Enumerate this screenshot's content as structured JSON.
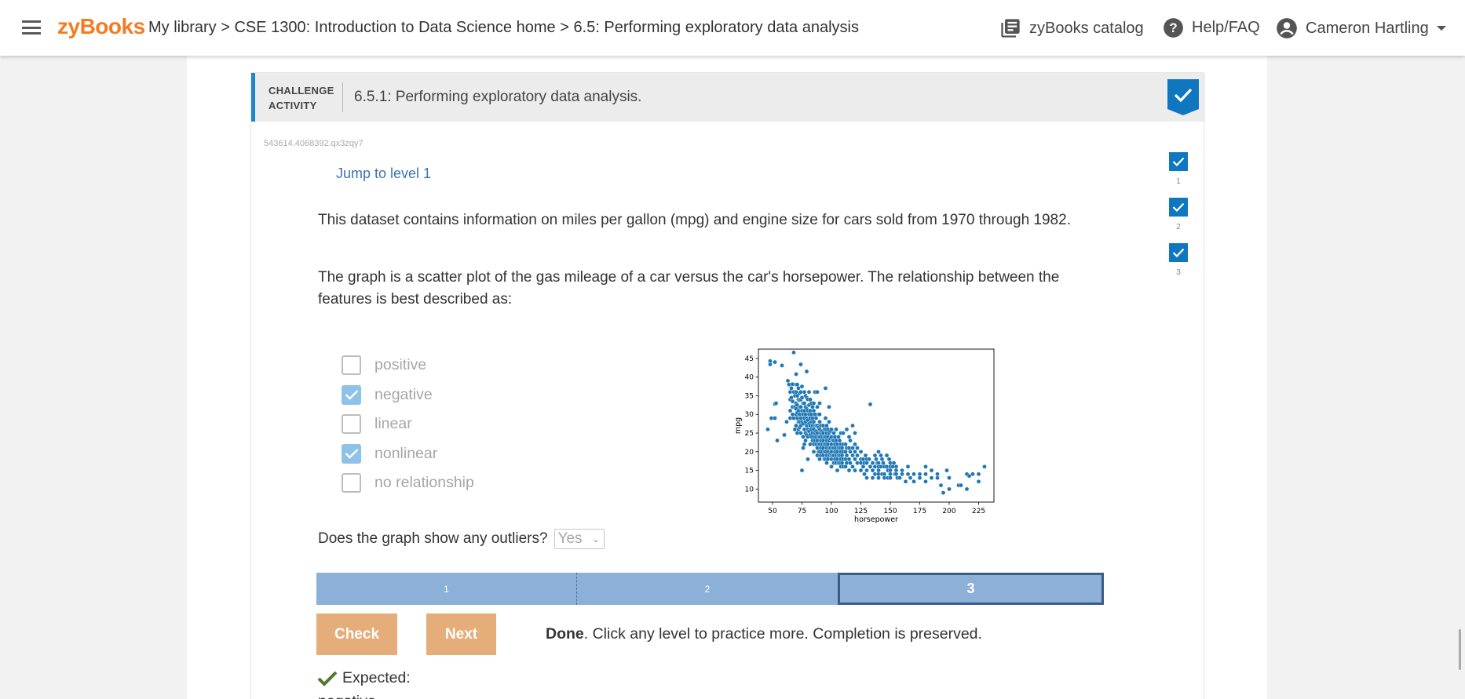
{
  "header": {
    "logo": "zyBooks",
    "breadcrumb": [
      {
        "label": "My library"
      },
      {
        "label": "CSE 1300: Introduction to Data Science home"
      },
      {
        "label": "6.5: Performing exploratory data analysis"
      }
    ],
    "separator": ">",
    "catalog_label": "zyBooks catalog",
    "help_label": "Help/FAQ",
    "user_name": "Cameron Hartling"
  },
  "activity": {
    "type_label_line1": "CHALLENGE",
    "type_label_line2": "ACTIVITY",
    "title": "6.5.1: Performing exploratory data analysis.",
    "id": "543614.4068392.qx3zqy7",
    "jump_label": "Jump to level 1",
    "level_indicators": [
      "1",
      "2",
      "3"
    ],
    "description": "This dataset contains information on miles per gallon (mpg) and engine size for cars sold from 1970 through 1982.",
    "question": "The graph is a scatter plot of the gas mileage of a car versus the car's horsepower. The relationship between the features is best described as:",
    "options": [
      {
        "label": "positive",
        "checked": false
      },
      {
        "label": "negative",
        "checked": true
      },
      {
        "label": "linear",
        "checked": false
      },
      {
        "label": "nonlinear",
        "checked": true
      },
      {
        "label": "no relationship",
        "checked": false
      }
    ],
    "outlier_question": "Does the graph show any outliers?",
    "outlier_answer": "Yes",
    "levels": [
      "1",
      "2",
      "3"
    ],
    "current_level": "3",
    "check_label": "Check",
    "next_label": "Next",
    "status_bold": "Done",
    "status_rest": ". Click any level to practice more. Completion is preserved.",
    "expected_label": "Expected:",
    "expected_answer": "negative"
  },
  "colors": {
    "brand": "#f47b20",
    "accent": "#1f86c8",
    "button": "#e5ad7a",
    "level_bar": "#8db0d8",
    "point": "#1f77b4"
  },
  "chart_data": {
    "type": "scatter",
    "xlabel": "horsepower",
    "ylabel": "mpg",
    "xlim": [
      38,
      238
    ],
    "ylim": [
      6.5,
      47.5
    ],
    "xticks": [
      50,
      75,
      100,
      125,
      150,
      175,
      200,
      225
    ],
    "yticks": [
      10,
      15,
      20,
      25,
      30,
      35,
      40,
      45
    ],
    "points": [
      [
        46,
        26
      ],
      [
        48,
        43.4
      ],
      [
        48,
        44.3
      ],
      [
        49,
        29
      ],
      [
        52,
        29
      ],
      [
        52,
        32.8
      ],
      [
        52,
        44
      ],
      [
        53,
        33
      ],
      [
        54,
        23
      ],
      [
        58,
        43.1
      ],
      [
        60,
        24.5
      ],
      [
        62,
        28
      ],
      [
        63,
        39
      ],
      [
        64,
        38
      ],
      [
        65,
        36
      ],
      [
        65,
        34
      ],
      [
        65,
        31
      ],
      [
        65,
        29
      ],
      [
        66,
        37
      ],
      [
        66,
        34.5
      ],
      [
        67,
        38.1
      ],
      [
        67,
        33.5
      ],
      [
        67,
        32
      ],
      [
        67,
        30
      ],
      [
        68,
        46.6
      ],
      [
        68,
        36
      ],
      [
        68,
        29
      ],
      [
        69,
        35
      ],
      [
        69,
        32
      ],
      [
        69,
        26
      ],
      [
        70,
        40.8
      ],
      [
        70,
        38
      ],
      [
        70,
        36
      ],
      [
        70,
        33
      ],
      [
        70,
        31.5
      ],
      [
        70,
        30
      ],
      [
        70,
        27
      ],
      [
        71,
        38
      ],
      [
        71,
        35
      ],
      [
        71,
        32.5
      ],
      [
        71,
        30.5
      ],
      [
        71,
        29
      ],
      [
        71,
        25
      ],
      [
        72,
        37
      ],
      [
        72,
        34
      ],
      [
        72,
        31
      ],
      [
        72,
        28
      ],
      [
        72,
        26
      ],
      [
        73,
        35.7
      ],
      [
        73,
        33.8
      ],
      [
        73,
        32
      ],
      [
        73,
        30
      ],
      [
        73,
        28
      ],
      [
        73,
        26.5
      ],
      [
        74,
        43.4
      ],
      [
        74,
        36
      ],
      [
        74,
        34
      ],
      [
        74,
        32
      ],
      [
        74,
        29
      ],
      [
        74,
        27
      ],
      [
        74,
        25
      ],
      [
        75,
        37.5
      ],
      [
        75,
        34.5
      ],
      [
        75,
        31
      ],
      [
        75,
        28
      ],
      [
        75,
        15
      ],
      [
        76,
        33
      ],
      [
        76,
        30
      ],
      [
        76,
        27.5
      ],
      [
        76,
        24
      ],
      [
        76,
        21
      ],
      [
        77,
        36
      ],
      [
        77,
        33
      ],
      [
        77,
        31
      ],
      [
        77,
        29
      ],
      [
        77,
        26
      ],
      [
        77,
        22
      ],
      [
        78,
        35
      ],
      [
        78,
        32
      ],
      [
        78,
        30
      ],
      [
        78,
        28
      ],
      [
        78,
        25
      ],
      [
        78,
        23
      ],
      [
        79,
        41.5
      ],
      [
        79,
        34.5
      ],
      [
        79,
        31.5
      ],
      [
        79,
        29
      ],
      [
        79,
        27
      ],
      [
        79,
        24.5
      ],
      [
        80,
        34
      ],
      [
        80,
        31
      ],
      [
        80,
        28.5
      ],
      [
        80,
        26
      ],
      [
        80,
        24
      ],
      [
        80,
        18
      ],
      [
        81,
        36
      ],
      [
        81,
        32.5
      ],
      [
        81,
        30
      ],
      [
        81,
        27.5
      ],
      [
        81,
        25.5
      ],
      [
        82,
        34
      ],
      [
        82,
        31
      ],
      [
        82,
        29
      ],
      [
        82,
        27
      ],
      [
        82,
        24.5
      ],
      [
        82,
        22
      ],
      [
        83,
        33
      ],
      [
        83,
        30
      ],
      [
        83,
        28
      ],
      [
        83,
        26
      ],
      [
        83,
        24
      ],
      [
        84,
        32
      ],
      [
        84,
        29
      ],
      [
        84,
        27
      ],
      [
        84,
        25
      ],
      [
        84,
        23
      ],
      [
        85,
        33
      ],
      [
        85,
        31
      ],
      [
        85,
        28
      ],
      [
        85,
        26
      ],
      [
        85,
        24
      ],
      [
        85,
        22
      ],
      [
        85,
        20
      ],
      [
        86,
        36
      ],
      [
        86,
        30
      ],
      [
        86,
        27
      ],
      [
        86,
        25
      ],
      [
        86,
        23
      ],
      [
        87,
        29
      ],
      [
        87,
        27
      ],
      [
        87,
        25.5
      ],
      [
        87,
        24
      ],
      [
        87,
        22
      ],
      [
        88,
        36
      ],
      [
        88,
        32
      ],
      [
        88,
        27
      ],
      [
        88,
        25
      ],
      [
        88,
        23
      ],
      [
        88,
        21
      ],
      [
        88,
        19
      ],
      [
        89,
        30
      ],
      [
        89,
        26.5
      ],
      [
        89,
        24
      ],
      [
        89,
        22
      ],
      [
        89,
        20
      ],
      [
        90,
        33
      ],
      [
        90,
        30
      ],
      [
        90,
        28
      ],
      [
        90,
        26
      ],
      [
        90,
        24
      ],
      [
        90,
        22
      ],
      [
        90,
        20
      ],
      [
        90,
        18
      ],
      [
        91,
        27
      ],
      [
        91,
        25
      ],
      [
        91,
        23
      ],
      [
        91,
        21
      ],
      [
        91,
        19
      ],
      [
        92,
        25.5
      ],
      [
        92,
        24
      ],
      [
        92,
        22
      ],
      [
        92,
        20
      ],
      [
        93,
        27
      ],
      [
        93,
        25
      ],
      [
        93,
        23
      ],
      [
        93,
        21
      ],
      [
        93,
        19
      ],
      [
        94,
        26
      ],
      [
        94,
        24
      ],
      [
        94,
        22
      ],
      [
        94,
        20
      ],
      [
        94,
        18
      ],
      [
        95,
        37
      ],
      [
        95,
        29
      ],
      [
        95,
        26
      ],
      [
        95,
        24
      ],
      [
        95,
        22
      ],
      [
        95,
        20
      ],
      [
        95,
        18
      ],
      [
        96,
        27
      ],
      [
        96,
        25
      ],
      [
        96,
        23
      ],
      [
        96,
        21
      ],
      [
        96,
        19
      ],
      [
        96,
        17
      ],
      [
        97,
        26
      ],
      [
        97,
        24
      ],
      [
        97,
        22
      ],
      [
        97,
        20
      ],
      [
        97,
        18
      ],
      [
        98,
        32
      ],
      [
        98,
        28
      ],
      [
        98,
        25
      ],
      [
        98,
        23
      ],
      [
        98,
        21
      ],
      [
        98,
        19
      ],
      [
        99,
        25.5
      ],
      [
        99,
        23.5
      ],
      [
        99,
        21
      ],
      [
        99,
        19.5
      ],
      [
        100,
        26
      ],
      [
        100,
        24
      ],
      [
        100,
        22
      ],
      [
        100,
        20
      ],
      [
        100,
        19
      ],
      [
        100,
        18
      ],
      [
        100,
        16
      ],
      [
        101,
        23
      ],
      [
        101,
        21
      ],
      [
        101,
        19
      ],
      [
        102,
        25
      ],
      [
        102,
        23
      ],
      [
        102,
        21
      ],
      [
        102,
        19
      ],
      [
        102,
        17
      ],
      [
        103,
        24
      ],
      [
        103,
        22
      ],
      [
        103,
        20
      ],
      [
        103,
        18
      ],
      [
        104,
        26
      ],
      [
        104,
        23
      ],
      [
        104,
        21
      ],
      [
        104,
        19
      ],
      [
        104,
        17
      ],
      [
        105,
        22
      ],
      [
        105,
        20
      ],
      [
        105,
        18
      ],
      [
        105,
        15
      ],
      [
        106,
        24
      ],
      [
        106,
        21
      ],
      [
        106,
        19
      ],
      [
        106,
        17
      ],
      [
        107,
        23
      ],
      [
        107,
        21
      ],
      [
        107,
        19
      ],
      [
        107,
        17
      ],
      [
        108,
        25
      ],
      [
        108,
        22
      ],
      [
        108,
        20
      ],
      [
        108,
        18
      ],
      [
        108,
        16
      ],
      [
        109,
        21
      ],
      [
        109,
        19
      ],
      [
        109,
        17
      ],
      [
        110,
        25
      ],
      [
        110,
        22
      ],
      [
        110,
        20
      ],
      [
        110,
        18
      ],
      [
        110,
        16
      ],
      [
        112,
        22
      ],
      [
        112,
        20
      ],
      [
        112,
        18
      ],
      [
        112,
        16
      ],
      [
        113,
        26
      ],
      [
        113,
        21
      ],
      [
        113,
        19
      ],
      [
        113,
        17
      ],
      [
        115,
        24
      ],
      [
        115,
        21
      ],
      [
        115,
        18
      ],
      [
        115,
        15
      ],
      [
        116,
        23
      ],
      [
        116,
        20
      ],
      [
        116,
        17
      ],
      [
        118,
        27
      ],
      [
        118,
        21
      ],
      [
        118,
        19
      ],
      [
        118,
        16
      ],
      [
        120,
        25
      ],
      [
        120,
        22
      ],
      [
        120,
        20
      ],
      [
        120,
        18
      ],
      [
        120,
        15
      ],
      [
        122,
        21
      ],
      [
        122,
        19
      ],
      [
        122,
        17
      ],
      [
        125,
        20
      ],
      [
        125,
        18
      ],
      [
        125,
        17
      ],
      [
        125,
        15
      ],
      [
        127,
        18
      ],
      [
        127,
        16
      ],
      [
        128,
        17
      ],
      [
        128,
        14
      ],
      [
        129,
        19
      ],
      [
        130,
        18
      ],
      [
        130,
        17
      ],
      [
        130,
        15
      ],
      [
        130,
        13
      ],
      [
        132,
        18
      ],
      [
        133,
        32.7
      ],
      [
        133,
        16
      ],
      [
        135,
        17
      ],
      [
        135,
        15
      ],
      [
        135,
        13
      ],
      [
        137,
        19
      ],
      [
        137,
        16
      ],
      [
        137,
        14
      ],
      [
        138,
        18
      ],
      [
        139,
        17
      ],
      [
        140,
        20
      ],
      [
        140,
        17
      ],
      [
        140,
        16
      ],
      [
        140,
        15
      ],
      [
        140,
        14
      ],
      [
        140,
        13
      ],
      [
        142,
        19
      ],
      [
        142,
        16
      ],
      [
        143,
        18
      ],
      [
        143,
        14
      ],
      [
        144,
        17
      ],
      [
        145,
        16
      ],
      [
        145,
        14
      ],
      [
        145,
        13
      ],
      [
        147,
        19
      ],
      [
        147,
        16
      ],
      [
        148,
        15
      ],
      [
        148,
        13
      ],
      [
        149,
        18
      ],
      [
        150,
        17
      ],
      [
        150,
        16
      ],
      [
        150,
        15
      ],
      [
        150,
        14
      ],
      [
        150,
        13
      ],
      [
        152,
        16
      ],
      [
        153,
        17
      ],
      [
        154,
        14
      ],
      [
        155,
        16
      ],
      [
        155,
        15
      ],
      [
        155,
        14
      ],
      [
        156,
        13
      ],
      [
        158,
        13
      ],
      [
        160,
        15
      ],
      [
        160,
        14
      ],
      [
        163,
        12
      ],
      [
        165,
        16
      ],
      [
        165,
        14
      ],
      [
        167,
        13
      ],
      [
        170,
        14
      ],
      [
        170,
        12
      ],
      [
        175,
        14
      ],
      [
        175,
        13
      ],
      [
        180,
        16
      ],
      [
        180,
        14
      ],
      [
        180,
        12
      ],
      [
        185,
        15
      ],
      [
        185,
        13
      ],
      [
        190,
        14
      ],
      [
        190,
        13
      ],
      [
        193,
        11
      ],
      [
        195,
        9
      ],
      [
        198,
        15
      ],
      [
        200,
        10
      ],
      [
        200,
        13
      ],
      [
        208,
        11
      ],
      [
        210,
        11
      ],
      [
        215,
        10
      ],
      [
        215,
        14
      ],
      [
        217,
        13.5
      ],
      [
        220,
        14
      ],
      [
        225,
        14
      ],
      [
        225,
        12
      ],
      [
        230,
        16
      ]
    ]
  }
}
